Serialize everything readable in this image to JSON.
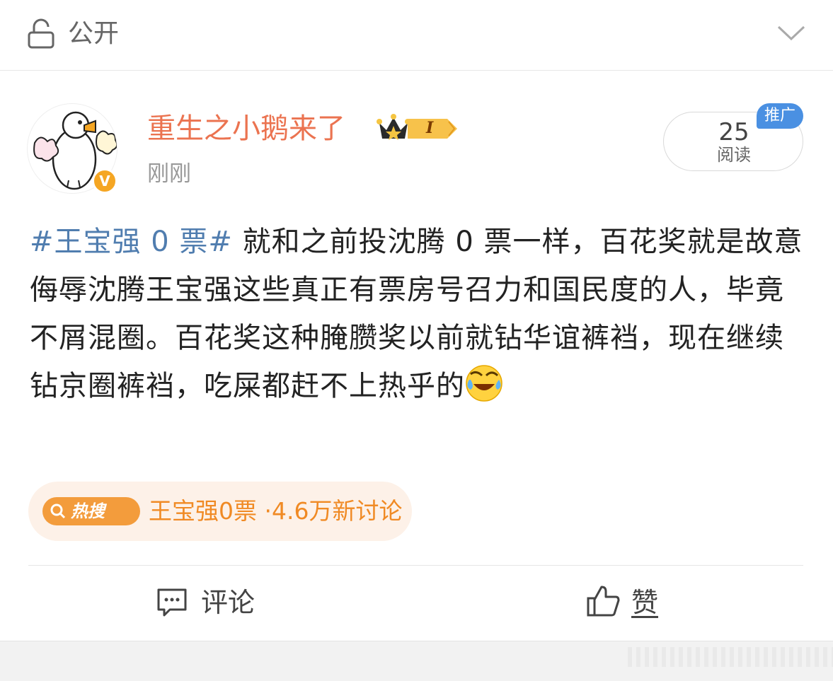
{
  "header": {
    "visibility_label": "公开",
    "lock_icon": "lock-icon",
    "expand_icon": "chevron-down-icon"
  },
  "post": {
    "author": {
      "name": "重生之小鹅来了",
      "avatar": "goose-avatar",
      "verified_badge": "V",
      "member_level": "I",
      "member_icon": "crown-icon"
    },
    "timestamp": "刚刚",
    "read_stats": {
      "count": "25",
      "label": "阅读"
    },
    "promo_tag": "推广",
    "body": {
      "hashtag": "#王宝强 0 票#",
      "text": " 就和之前投沈腾 0 票一样，百花奖就是故意侮辱沈腾王宝强这些真正有票房号召力和国民度的人，毕竟不屑混圈。百花奖这种腌臜奖以前就钻华谊裤裆，现在继续钻京圈裤裆，吃屎都赶不上热乎的",
      "emoji": "laugh-cry-emoji"
    },
    "hot_search": {
      "tag_label": "热搜",
      "topic": "王宝强0票",
      "separator": "·",
      "discussion": "4.6万新讨论"
    }
  },
  "actions": {
    "comment_label": "评论",
    "like_label": "赞"
  },
  "colors": {
    "username": "#eb7350",
    "hashtag": "#507daf",
    "hot_accent": "#f08a24",
    "promo_tag": "#4a90e2",
    "verified": "#f5a623"
  }
}
